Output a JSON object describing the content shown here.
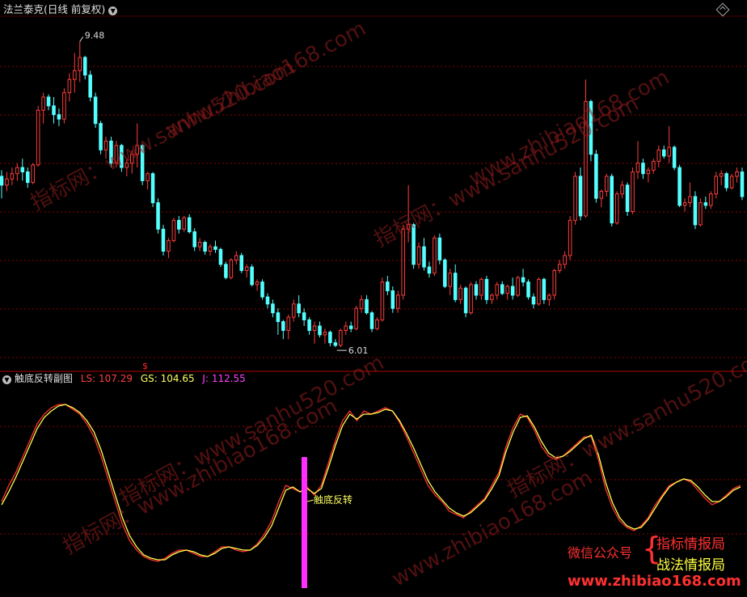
{
  "header": {
    "title": "法兰泰克(日线 前复权)"
  },
  "indicator": {
    "name": "触底反转副图",
    "ls_text": "LS: 107.29",
    "gs_text": "GS: 104.65",
    "j_text": "J: 112.55",
    "signal_label": "触底反转"
  },
  "price_marks": {
    "high_label": "9.48",
    "low_label": "6.01",
    "marker": "$"
  },
  "watermarks": [
    "www.zhibiao168.com",
    "指标网：www.sanhu520.com",
    "指标网：www.sanhu520.com",
    "www.zhibiao168.com",
    "指标网：www.sanhu520.com",
    "指标网：www.zhibiao168.com"
  ],
  "wechat": {
    "label": "微信公众号",
    "line1": "指标情报局",
    "line2": "战法情报局",
    "url": "www.zhibiao168.com"
  },
  "colors": {
    "up": "#ff3c3c",
    "down": "#54ffff",
    "ls": "#ff3030",
    "gs": "#ffff50",
    "signal": "#ff30ff",
    "grid": "#8a0000"
  },
  "chart_data": [
    {
      "type": "candlestick",
      "title": "法兰泰克(日线 前复权)",
      "ylim": [
        5.8,
        9.75
      ],
      "annotations": [
        {
          "label": "9.48",
          "value": 9.48
        },
        {
          "label": "6.01",
          "value": 6.01
        }
      ],
      "ohlc": [
        [
          7.95,
          8.02,
          7.7,
          7.85
        ],
        [
          7.85,
          8.0,
          7.78,
          7.92
        ],
        [
          7.92,
          8.05,
          7.85,
          7.98
        ],
        [
          7.98,
          8.1,
          7.9,
          8.05
        ],
        [
          8.05,
          8.15,
          7.9,
          8.0
        ],
        [
          8.0,
          8.05,
          7.82,
          7.88
        ],
        [
          7.88,
          8.1,
          7.86,
          8.08
        ],
        [
          8.08,
          8.75,
          8.06,
          8.7
        ],
        [
          8.7,
          8.9,
          8.55,
          8.85
        ],
        [
          8.85,
          8.88,
          8.7,
          8.75
        ],
        [
          8.75,
          8.85,
          8.55,
          8.65
        ],
        [
          8.65,
          8.72,
          8.52,
          8.6
        ],
        [
          8.6,
          8.95,
          8.55,
          8.9
        ],
        [
          8.9,
          9.12,
          8.8,
          9.05
        ],
        [
          9.05,
          9.35,
          8.9,
          9.15
        ],
        [
          9.15,
          9.48,
          9.02,
          9.3
        ],
        [
          9.3,
          9.32,
          9.05,
          9.1
        ],
        [
          9.1,
          9.15,
          8.8,
          8.85
        ],
        [
          8.85,
          8.9,
          8.5,
          8.55
        ],
        [
          8.55,
          8.58,
          8.2,
          8.25
        ],
        [
          8.25,
          8.4,
          8.15,
          8.35
        ],
        [
          8.35,
          8.4,
          8.05,
          8.1
        ],
        [
          8.1,
          8.35,
          8.05,
          8.3
        ],
        [
          8.3,
          8.32,
          8.0,
          8.05
        ],
        [
          8.05,
          8.15,
          7.95,
          8.1
        ],
        [
          8.1,
          8.25,
          7.98,
          8.2
        ],
        [
          8.2,
          8.55,
          8.05,
          8.3
        ],
        [
          8.3,
          8.32,
          7.85,
          7.9
        ],
        [
          7.9,
          8.0,
          7.8,
          7.98
        ],
        [
          7.98,
          8.0,
          7.6,
          7.65
        ],
        [
          7.65,
          7.7,
          7.3,
          7.35
        ],
        [
          7.35,
          7.4,
          7.05,
          7.1
        ],
        [
          7.1,
          7.25,
          7.02,
          7.22
        ],
        [
          7.22,
          7.48,
          7.2,
          7.45
        ],
        [
          7.45,
          7.5,
          7.3,
          7.35
        ],
        [
          7.35,
          7.5,
          7.32,
          7.48
        ],
        [
          7.48,
          7.52,
          7.3,
          7.32
        ],
        [
          7.32,
          7.36,
          7.1,
          7.15
        ],
        [
          7.15,
          7.25,
          7.1,
          7.2
        ],
        [
          7.2,
          7.22,
          7.06,
          7.1
        ],
        [
          7.1,
          7.18,
          7.05,
          7.15
        ],
        [
          7.15,
          7.22,
          7.08,
          7.12
        ],
        [
          7.12,
          7.14,
          6.92,
          6.95
        ],
        [
          6.95,
          6.98,
          6.78,
          6.8
        ],
        [
          6.8,
          7.02,
          6.78,
          7.0
        ],
        [
          7.0,
          7.1,
          6.95,
          7.05
        ],
        [
          7.05,
          7.08,
          6.85,
          6.88
        ],
        [
          6.88,
          6.95,
          6.8,
          6.92
        ],
        [
          6.92,
          6.95,
          6.7,
          6.72
        ],
        [
          6.72,
          6.78,
          6.65,
          6.75
        ],
        [
          6.75,
          6.78,
          6.55,
          6.58
        ],
        [
          6.58,
          6.62,
          6.45,
          6.5
        ],
        [
          6.5,
          6.55,
          6.35,
          6.4
        ],
        [
          6.4,
          6.45,
          6.15,
          6.3
        ],
        [
          6.3,
          6.32,
          6.1,
          6.2
        ],
        [
          6.2,
          6.38,
          6.1,
          6.35
        ],
        [
          6.35,
          6.55,
          6.3,
          6.5
        ],
        [
          6.5,
          6.6,
          6.35,
          6.4
        ],
        [
          6.4,
          6.45,
          6.25,
          6.32
        ],
        [
          6.32,
          6.35,
          6.15,
          6.2
        ],
        [
          6.2,
          6.3,
          6.05,
          6.25
        ],
        [
          6.25,
          6.3,
          6.12,
          6.15
        ],
        [
          6.15,
          6.22,
          6.05,
          6.18
        ],
        [
          6.18,
          6.2,
          6.02,
          6.06
        ],
        [
          6.06,
          6.1,
          6.01,
          6.03
        ],
        [
          6.03,
          6.22,
          6.01,
          6.2
        ],
        [
          6.2,
          6.3,
          6.15,
          6.25
        ],
        [
          6.25,
          6.3,
          6.18,
          6.22
        ],
        [
          6.22,
          6.48,
          6.2,
          6.45
        ],
        [
          6.45,
          6.6,
          6.4,
          6.55
        ],
        [
          6.55,
          6.6,
          6.38,
          6.4
        ],
        [
          6.4,
          6.42,
          6.18,
          6.22
        ],
        [
          6.22,
          6.35,
          6.2,
          6.32
        ],
        [
          6.32,
          6.8,
          6.3,
          6.75
        ],
        [
          6.75,
          6.82,
          6.6,
          6.65
        ],
        [
          6.65,
          6.7,
          6.4,
          6.45
        ],
        [
          6.45,
          6.65,
          6.4,
          6.6
        ],
        [
          6.6,
          7.4,
          6.55,
          7.35
        ],
        [
          7.35,
          7.85,
          7.2,
          7.4
        ],
        [
          7.4,
          7.42,
          6.9,
          6.95
        ],
        [
          6.95,
          7.2,
          6.9,
          7.15
        ],
        [
          7.15,
          7.25,
          6.88,
          6.92
        ],
        [
          6.92,
          6.98,
          6.8,
          6.85
        ],
        [
          6.85,
          7.28,
          6.82,
          7.25
        ],
        [
          7.25,
          7.3,
          6.95,
          7.0
        ],
        [
          7.0,
          7.02,
          6.68,
          6.7
        ],
        [
          6.7,
          6.9,
          6.6,
          6.85
        ],
        [
          6.85,
          6.95,
          6.52,
          6.55
        ],
        [
          6.55,
          6.72,
          6.5,
          6.68
        ],
        [
          6.68,
          6.7,
          6.35,
          6.4
        ],
        [
          6.4,
          6.75,
          6.38,
          6.72
        ],
        [
          6.72,
          6.76,
          6.55,
          6.6
        ],
        [
          6.6,
          6.8,
          6.55,
          6.78
        ],
        [
          6.78,
          6.82,
          6.5,
          6.55
        ],
        [
          6.55,
          6.62,
          6.5,
          6.6
        ],
        [
          6.6,
          6.75,
          6.55,
          6.72
        ],
        [
          6.72,
          6.76,
          6.6,
          6.62
        ],
        [
          6.62,
          6.72,
          6.55,
          6.7
        ],
        [
          6.7,
          6.8,
          6.55,
          6.6
        ],
        [
          6.6,
          6.82,
          6.58,
          6.8
        ],
        [
          6.8,
          6.9,
          6.7,
          6.75
        ],
        [
          6.75,
          6.78,
          6.55,
          6.58
        ],
        [
          6.58,
          6.62,
          6.45,
          6.5
        ],
        [
          6.5,
          6.8,
          6.48,
          6.78
        ],
        [
          6.78,
          6.8,
          6.5,
          6.55
        ],
        [
          6.55,
          6.62,
          6.48,
          6.6
        ],
        [
          6.6,
          6.9,
          6.55,
          6.88
        ],
        [
          6.88,
          7.0,
          6.85,
          6.95
        ],
        [
          6.95,
          7.1,
          6.9,
          7.05
        ],
        [
          7.05,
          7.5,
          7.0,
          7.45
        ],
        [
          7.45,
          8.0,
          7.4,
          7.95
        ],
        [
          7.95,
          8.05,
          7.45,
          7.5
        ],
        [
          7.5,
          9.05,
          7.48,
          8.8
        ],
        [
          8.8,
          8.82,
          8.12,
          8.2
        ],
        [
          8.2,
          8.25,
          7.65,
          7.7
        ],
        [
          7.7,
          7.8,
          7.6,
          7.78
        ],
        [
          7.78,
          7.98,
          7.72,
          7.95
        ],
        [
          7.95,
          7.98,
          7.38,
          7.42
        ],
        [
          7.42,
          7.78,
          7.4,
          7.75
        ],
        [
          7.75,
          7.9,
          7.7,
          7.85
        ],
        [
          7.85,
          7.88,
          7.5,
          7.55
        ],
        [
          7.55,
          8.05,
          7.52,
          8.0
        ],
        [
          8.0,
          8.35,
          7.92,
          8.1
        ],
        [
          8.1,
          8.15,
          7.92,
          7.98
        ],
        [
          7.98,
          8.05,
          7.88,
          8.02
        ],
        [
          8.02,
          8.15,
          7.98,
          8.12
        ],
        [
          8.12,
          8.3,
          8.05,
          8.25
        ],
        [
          8.25,
          8.3,
          8.15,
          8.18
        ],
        [
          8.18,
          8.52,
          8.1,
          8.28
        ],
        [
          8.28,
          8.3,
          8.02,
          8.05
        ],
        [
          8.05,
          8.08,
          7.6,
          7.62
        ],
        [
          7.62,
          7.7,
          7.55,
          7.65
        ],
        [
          7.65,
          7.88,
          7.6,
          7.72
        ],
        [
          7.72,
          7.78,
          7.35,
          7.4
        ],
        [
          7.4,
          7.7,
          7.38,
          7.65
        ],
        [
          7.65,
          7.72,
          7.58,
          7.62
        ],
        [
          7.62,
          7.78,
          7.58,
          7.75
        ],
        [
          7.75,
          8.0,
          7.7,
          7.95
        ],
        [
          7.95,
          8.02,
          7.85,
          7.98
        ],
        [
          7.98,
          8.0,
          7.78,
          7.82
        ],
        [
          7.82,
          7.98,
          7.8,
          7.95
        ],
        [
          7.95,
          8.05,
          7.88,
          8.0
        ],
        [
          8.0,
          8.05,
          7.68,
          7.72
        ]
      ]
    },
    {
      "type": "line",
      "title": "触底反转副图",
      "ylim": [
        -5,
        120
      ],
      "series": [
        {
          "name": "LS",
          "values": [
            48,
            58,
            66,
            76,
            86,
            96,
            102,
            106,
            108,
            108,
            105,
            102,
            96,
            88,
            76,
            62,
            48,
            34,
            24,
            18,
            14,
            12,
            11,
            13,
            16,
            18,
            18,
            16,
            14,
            14,
            17,
            20,
            20,
            18,
            17,
            18,
            22,
            28,
            36,
            48,
            58,
            56,
            54,
            57,
            52,
            58,
            72,
            86,
            98,
            104,
            98,
            104,
            102,
            104,
            106,
            104,
            97,
            88,
            78,
            68,
            58,
            52,
            48,
            42,
            40,
            38,
            42,
            46,
            50,
            58,
            66,
            82,
            94,
            102,
            100,
            92,
            82,
            76,
            74,
            76,
            80,
            84,
            88,
            88,
            74,
            56,
            44,
            36,
            32,
            30,
            33,
            38,
            46,
            52,
            58,
            60,
            62,
            60,
            55,
            50,
            46,
            48,
            52,
            56,
            58
          ]
        },
        {
          "name": "GS",
          "values": [
            46,
            54,
            63,
            73,
            83,
            93,
            100,
            104,
            107,
            108,
            106,
            103,
            98,
            91,
            80,
            66,
            52,
            38,
            27,
            20,
            15,
            13,
            12,
            12,
            15,
            17,
            18,
            17,
            15,
            14,
            16,
            19,
            20,
            19,
            18,
            18,
            21,
            26,
            33,
            44,
            55,
            57,
            54,
            56,
            53,
            56,
            69,
            83,
            95,
            102,
            99,
            102,
            102,
            103,
            105,
            104,
            98,
            90,
            81,
            71,
            61,
            54,
            49,
            44,
            41,
            39,
            41,
            45,
            49,
            56,
            64,
            79,
            91,
            100,
            101,
            94,
            85,
            78,
            75,
            76,
            79,
            83,
            87,
            89,
            77,
            60,
            47,
            38,
            33,
            31,
            32,
            37,
            44,
            51,
            57,
            60,
            62,
            61,
            57,
            52,
            48,
            48,
            51,
            55,
            57
          ]
        }
      ]
    }
  ]
}
